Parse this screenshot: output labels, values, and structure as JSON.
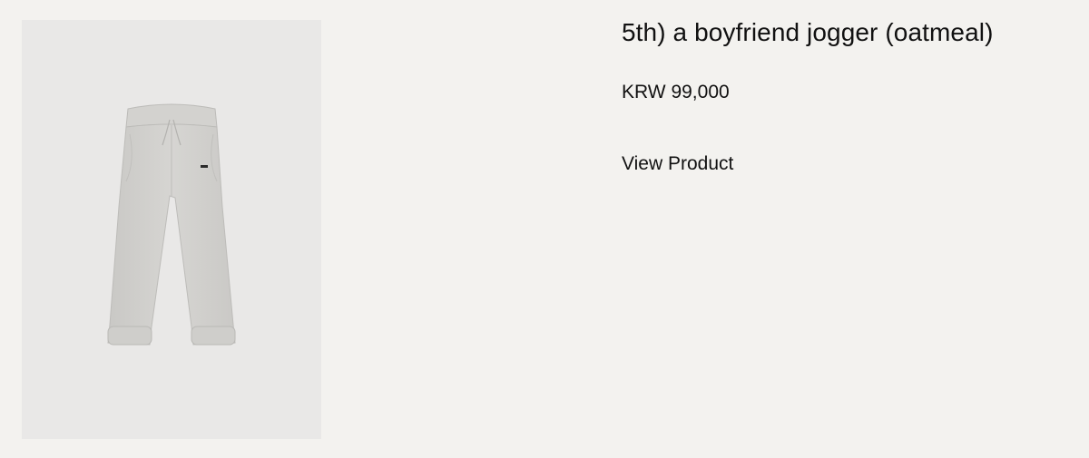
{
  "product": {
    "title": "5th) a boyfriend jogger (oatmeal)",
    "price": "KRW 99,000",
    "view_label": "View Product",
    "image_icon": "jogger-pants-image"
  }
}
